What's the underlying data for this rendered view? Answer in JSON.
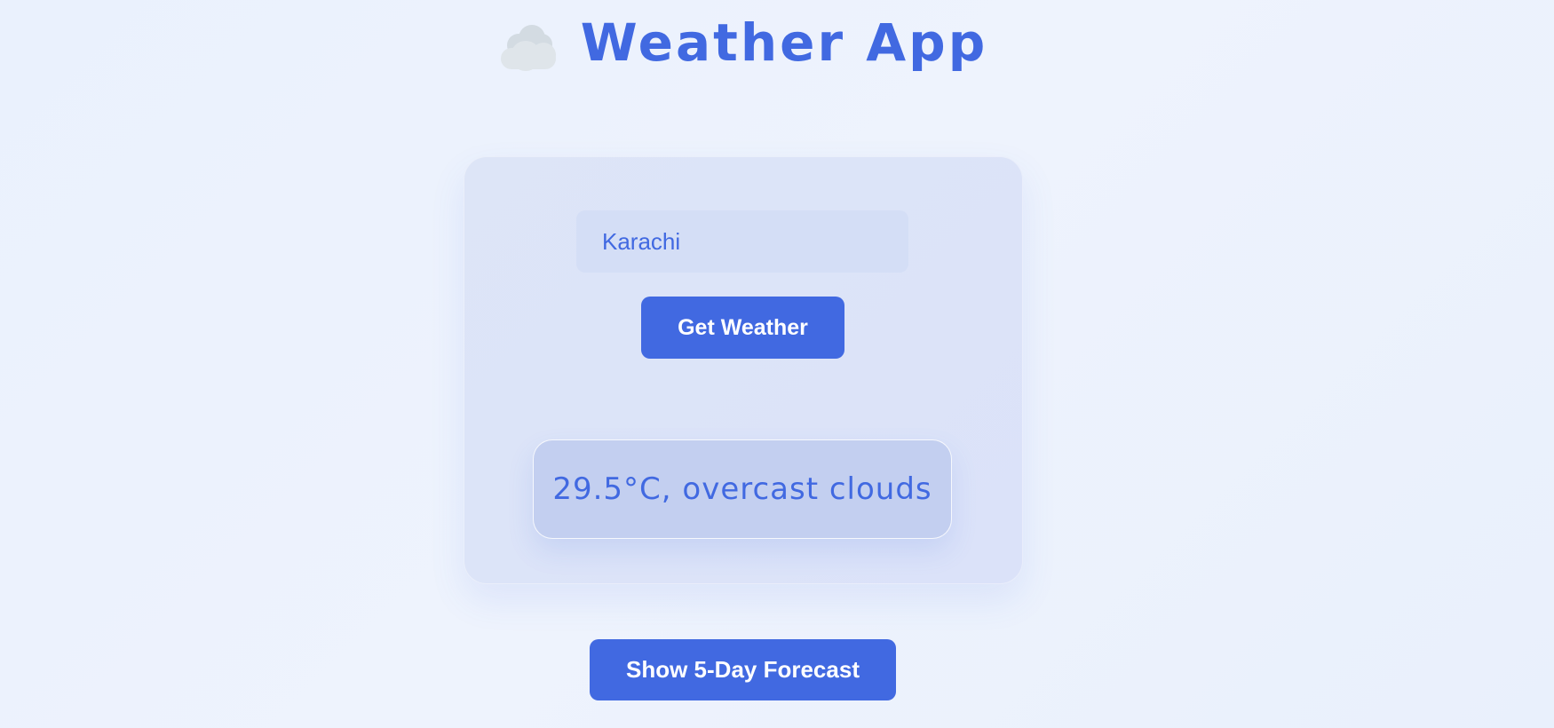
{
  "header": {
    "icon": "cloud-icon",
    "title": "Weather App"
  },
  "search": {
    "city_value": "Karachi",
    "button_label": "Get Weather"
  },
  "result": {
    "text": "29.5°C, overcast clouds"
  },
  "forecast": {
    "button_label": "Show 5-Day Forecast"
  },
  "colors": {
    "accent": "#4169e1",
    "background": "#eaf1fd",
    "card": "#dde5f7",
    "result_box": "#c3cff0"
  }
}
